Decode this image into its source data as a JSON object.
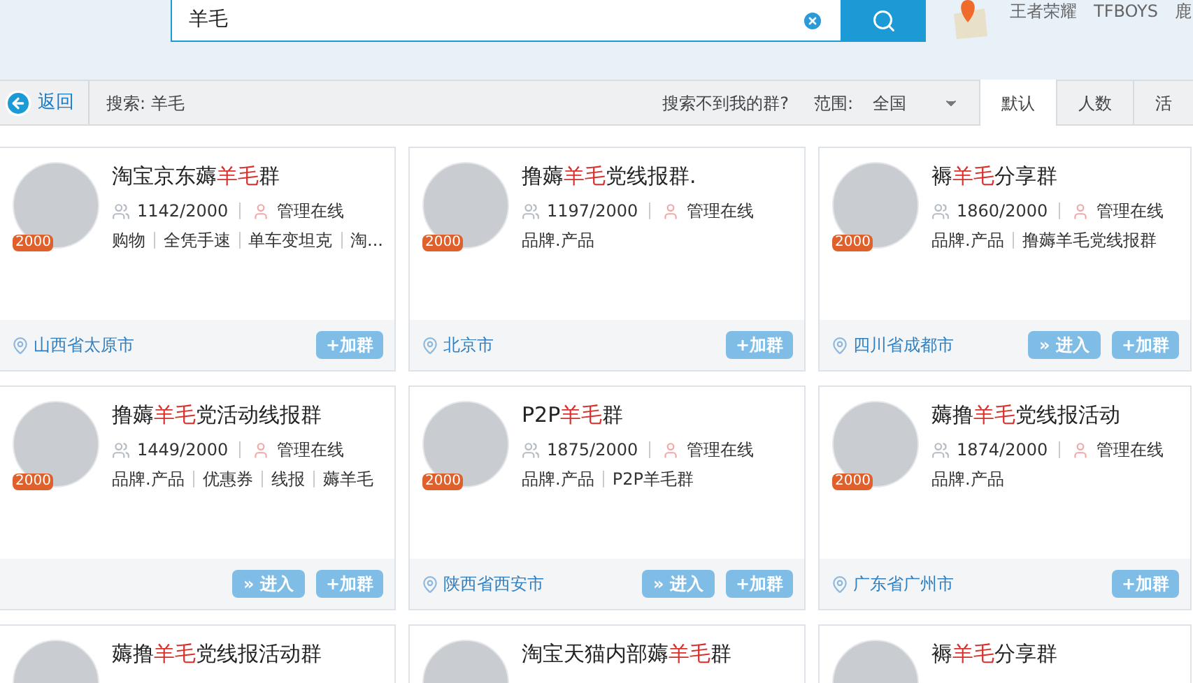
{
  "search": {
    "value": "羊毛"
  },
  "hot_words": [
    "王者荣耀",
    "TFBOYS",
    "鹿"
  ],
  "toolbar": {
    "back": "返回",
    "query": "搜索: 羊毛",
    "not_found": "搜索不到我的群?",
    "scope_label": "范围:",
    "scope_value": "全国"
  },
  "sort_tabs": [
    {
      "label": "默认",
      "selected": true
    },
    {
      "label": "人数",
      "selected": false
    },
    {
      "label": "活",
      "selected": false
    }
  ],
  "rows": [
    [
      {
        "name_parts": [
          {
            "text": "淘宝京东薅",
            "highlight": false
          },
          {
            "text": "羊毛",
            "highlight": true
          },
          {
            "text": "群",
            "highlight": false
          }
        ],
        "members": "1142/2000",
        "admin": "管理在线",
        "tags": [
          "购物",
          "全凭手速",
          "单车变坦克",
          "淘..."
        ],
        "badge": "2000",
        "location": "山西省太原市",
        "buttons": [
          {
            "kind": "join",
            "label": "+加群"
          }
        ]
      },
      {
        "name_parts": [
          {
            "text": "撸薅",
            "highlight": false
          },
          {
            "text": "羊毛",
            "highlight": true
          },
          {
            "text": "党线报群.",
            "highlight": false
          }
        ],
        "members": "1197/2000",
        "admin": "管理在线",
        "tags": [
          "品牌.产品"
        ],
        "badge": "2000",
        "location": "北京市",
        "buttons": [
          {
            "kind": "join",
            "label": "+加群"
          }
        ]
      },
      {
        "name_parts": [
          {
            "text": "褥",
            "highlight": false
          },
          {
            "text": "羊毛",
            "highlight": true
          },
          {
            "text": "分享群",
            "highlight": false
          }
        ],
        "members": "1860/2000",
        "admin": "管理在线",
        "tags": [
          "品牌.产品",
          "撸薅羊毛党线报群"
        ],
        "badge": "2000",
        "location": "四川省成都市",
        "buttons": [
          {
            "kind": "enter",
            "label": "» 进入"
          },
          {
            "kind": "join",
            "label": "+加群"
          }
        ]
      }
    ],
    [
      {
        "name_parts": [
          {
            "text": "撸薅",
            "highlight": false
          },
          {
            "text": "羊毛",
            "highlight": true
          },
          {
            "text": "党活动线报群",
            "highlight": false
          }
        ],
        "members": "1449/2000",
        "admin": "管理在线",
        "tags": [
          "品牌.产品",
          "优惠券",
          "线报",
          "薅羊毛"
        ],
        "badge": "2000",
        "buttons": [
          {
            "kind": "enter",
            "label": "» 进入"
          },
          {
            "kind": "join",
            "label": "+加群"
          }
        ]
      },
      {
        "name_parts": [
          {
            "text": "P2P",
            "highlight": false
          },
          {
            "text": "羊毛",
            "highlight": true
          },
          {
            "text": "群",
            "highlight": false
          }
        ],
        "members": "1875/2000",
        "admin": "管理在线",
        "tags": [
          "品牌.产品",
          "P2P羊毛群"
        ],
        "badge": "2000",
        "location": "陕西省西安市",
        "buttons": [
          {
            "kind": "enter",
            "label": "» 进入"
          },
          {
            "kind": "join",
            "label": "+加群"
          }
        ]
      },
      {
        "name_parts": [
          {
            "text": "薅撸",
            "highlight": false
          },
          {
            "text": "羊毛",
            "highlight": true
          },
          {
            "text": "党线报活动",
            "highlight": false
          }
        ],
        "members": "1874/2000",
        "admin": "管理在线",
        "tags": [
          "品牌.产品"
        ],
        "badge": "2000",
        "location": "广东省广州市",
        "buttons": [
          {
            "kind": "join",
            "label": "+加群"
          }
        ]
      }
    ],
    [
      {
        "name_parts": [
          {
            "text": "薅撸",
            "highlight": false
          },
          {
            "text": "羊毛",
            "highlight": true
          },
          {
            "text": "党线报活动群",
            "highlight": false
          }
        ]
      },
      {
        "name_parts": [
          {
            "text": "淘宝天猫内部薅",
            "highlight": false
          },
          {
            "text": "羊毛",
            "highlight": true
          },
          {
            "text": "群",
            "highlight": false
          }
        ]
      },
      {
        "name_parts": [
          {
            "text": "褥",
            "highlight": false
          },
          {
            "text": "羊毛",
            "highlight": true
          },
          {
            "text": "分享群",
            "highlight": false
          }
        ]
      }
    ]
  ]
}
